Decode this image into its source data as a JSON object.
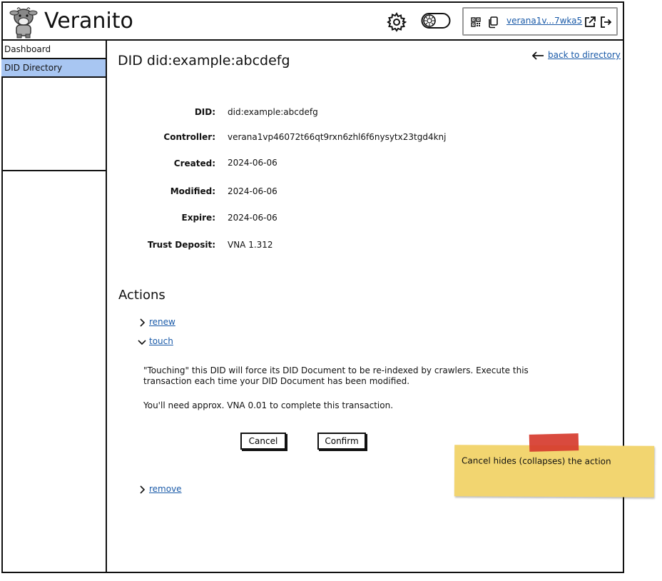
{
  "app": {
    "brand": "Veranito"
  },
  "header": {
    "wallet_address": "verana1v...7wka5",
    "icons": [
      "cow-logo-icon",
      "gear-icon",
      "toggle-icon",
      "qr-icon",
      "copy-icon",
      "external-link-icon",
      "logout-icon"
    ]
  },
  "sidebar": {
    "items": [
      {
        "label": "Dashboard",
        "active": false
      },
      {
        "label": "DID Directory",
        "active": true
      }
    ],
    "active_color": "#a8c6f2"
  },
  "page": {
    "title": "DID did:example:abcdefg",
    "back_link": "back to directory"
  },
  "details": {
    "fields": [
      {
        "label": "DID:",
        "value": "did:example:abcdefg"
      },
      {
        "label": "Controller:",
        "value": "verana1vp46072t66qt9rxn6zhl6f6nysytx23tgd4knj"
      },
      {
        "label": "Created:",
        "value": "2024-06-06"
      },
      {
        "label": "Modified:",
        "value": "2024-06-06"
      },
      {
        "label": "Expire:",
        "value": "2024-06-06"
      },
      {
        "label": "Trust Deposit:",
        "value": "VNA 1.312"
      }
    ]
  },
  "actions": {
    "title": "Actions",
    "items": [
      {
        "label": "renew",
        "expanded": false
      },
      {
        "label": "touch",
        "expanded": true
      },
      {
        "label": "remove",
        "expanded": false
      }
    ],
    "touch": {
      "description": "\"Touching\" this DID will force its DID Document to be re-indexed by crawlers. Execute this transaction each time your DID Document has been modified.",
      "cost_note": "You'll need approx. VNA 0.01 to complete this transaction.",
      "cancel_label": "Cancel",
      "confirm_label": "Confirm"
    }
  },
  "note": {
    "text": "Cancel hides (collapses) the action",
    "color": "#f2d570",
    "tape_color": "#d63b2e"
  },
  "colors": {
    "link": "#1a5aa8"
  }
}
